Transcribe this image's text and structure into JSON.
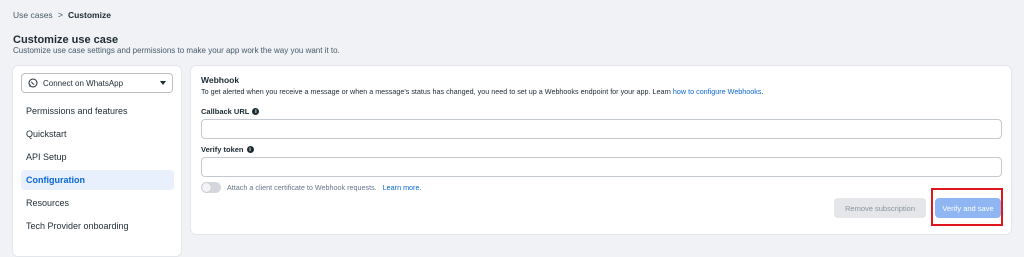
{
  "breadcrumb": {
    "parent": "Use cases",
    "separator": ">",
    "current": "Customize"
  },
  "header": {
    "title": "Customize use case",
    "subtitle": "Customize use case settings and permissions to make your app work the way you want it to."
  },
  "sidebar": {
    "selector_label": "Connect on WhatsApp",
    "items": [
      {
        "label": "Permissions and features"
      },
      {
        "label": "Quickstart"
      },
      {
        "label": "API Setup"
      },
      {
        "label": "Configuration",
        "active": true
      },
      {
        "label": "Resources"
      },
      {
        "label": "Tech Provider onboarding"
      }
    ]
  },
  "webhook": {
    "title": "Webhook",
    "description": "To get alerted when you receive a message or when a message's status has changed, you need to set up a Webhooks endpoint for your app. Learn ",
    "description_link": "how to configure Webhooks",
    "description_end": ".",
    "callback_label": "Callback URL",
    "callback_value": "",
    "verify_label": "Verify token",
    "verify_value": "",
    "cert_toggle_label": "Attach a client certificate to Webhook requests.",
    "cert_learn_more": "Learn more.",
    "cert_toggle_on": false,
    "remove_button": "Remove subscription",
    "verify_button": "Verify and save"
  },
  "colors": {
    "accent": "#0a66d8",
    "active_bg": "#e7f0fc",
    "verify_button_bg": "#8fb6f2",
    "highlight": "#e0161d",
    "whatsapp_icon": "whatsapp-icon"
  }
}
